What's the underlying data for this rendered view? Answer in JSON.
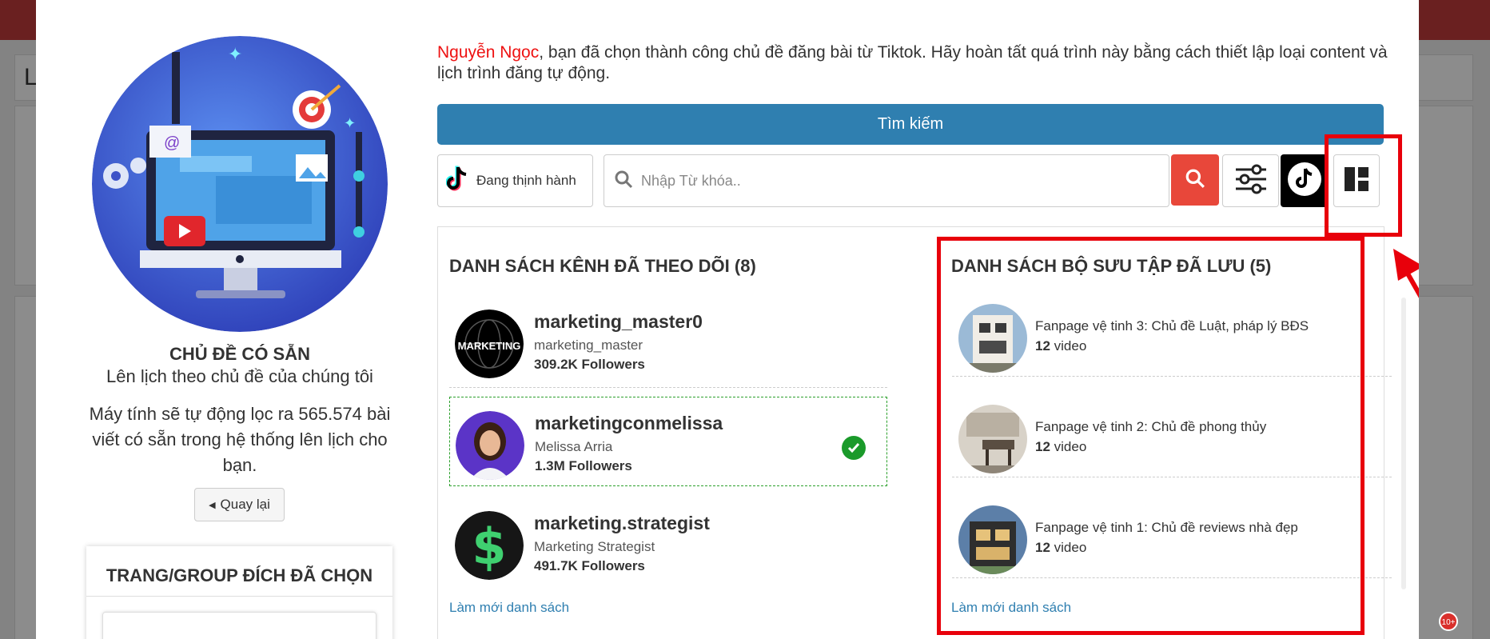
{
  "background": {
    "page_label_letter": "L",
    "notification_badge": "10+"
  },
  "left": {
    "topic_title": "CHỦ ĐỀ CÓ SẴN",
    "topic_subtitle": "Lên lịch theo chủ đề của chúng tôi",
    "topic_description": "Máy tính sẽ tự động lọc ra 565.574 bài viết có sẵn trong hệ thống lên lịch cho bạn.",
    "back_button": "Quay lại",
    "target_title": "TRANG/GROUP ĐÍCH ĐÃ CHỌN"
  },
  "intro": {
    "user_name": "Nguyễn Ngọc",
    "message": ", bạn đã chọn thành công chủ đề đăng bài từ Tiktok. Hãy hoàn tất quá trình này bằng cách thiết lập loại content và lịch trình đăng tự động."
  },
  "search": {
    "header_label": "Tìm kiếm",
    "trending_button": "Đang thịnh hành",
    "keyword_placeholder": "Nhập Từ khóa..",
    "keyword_value": ""
  },
  "channels": {
    "title": "DANH SÁCH KÊNH ĐÃ THEO DÕI (8)",
    "items": [
      {
        "name": "marketing_master0",
        "handle": "marketing_master",
        "followers": "309.2K Followers",
        "selected": false,
        "avatar_text": "MARKETING"
      },
      {
        "name": "marketingconmelissa",
        "handle": "Melissa Arria",
        "followers": "1.3M Followers",
        "selected": true
      },
      {
        "name": "marketing.strategist",
        "handle": "Marketing Strategist",
        "followers": "491.7K Followers",
        "selected": false,
        "avatar_text": "$"
      }
    ],
    "refresh_link": "Làm mới danh sách"
  },
  "collections": {
    "title": "DANH SÁCH BỘ SƯU TẬP ĐÃ LƯU (5)",
    "items": [
      {
        "name": "Fanpage vệ tinh 3: Chủ đề Luật, pháp lý BĐS",
        "count": "12",
        "unit": "video"
      },
      {
        "name": "Fanpage vệ tinh 2: Chủ đề phong thủy",
        "count": "12",
        "unit": "video"
      },
      {
        "name": "Fanpage vệ tinh 1: Chủ đề reviews nhà đẹp",
        "count": "12",
        "unit": "video"
      }
    ],
    "refresh_link": "Làm mới danh sách"
  },
  "colors": {
    "accent": "#2f7fb0",
    "search_button": "#e8473a",
    "highlight": "#e8000b",
    "selected_border": "#2ca02c"
  },
  "icons": [
    "tiktok-icon",
    "search-icon",
    "sliders-icon",
    "tiktok-logo-icon",
    "layout-grid-icon",
    "caret-left-icon",
    "check-icon"
  ]
}
